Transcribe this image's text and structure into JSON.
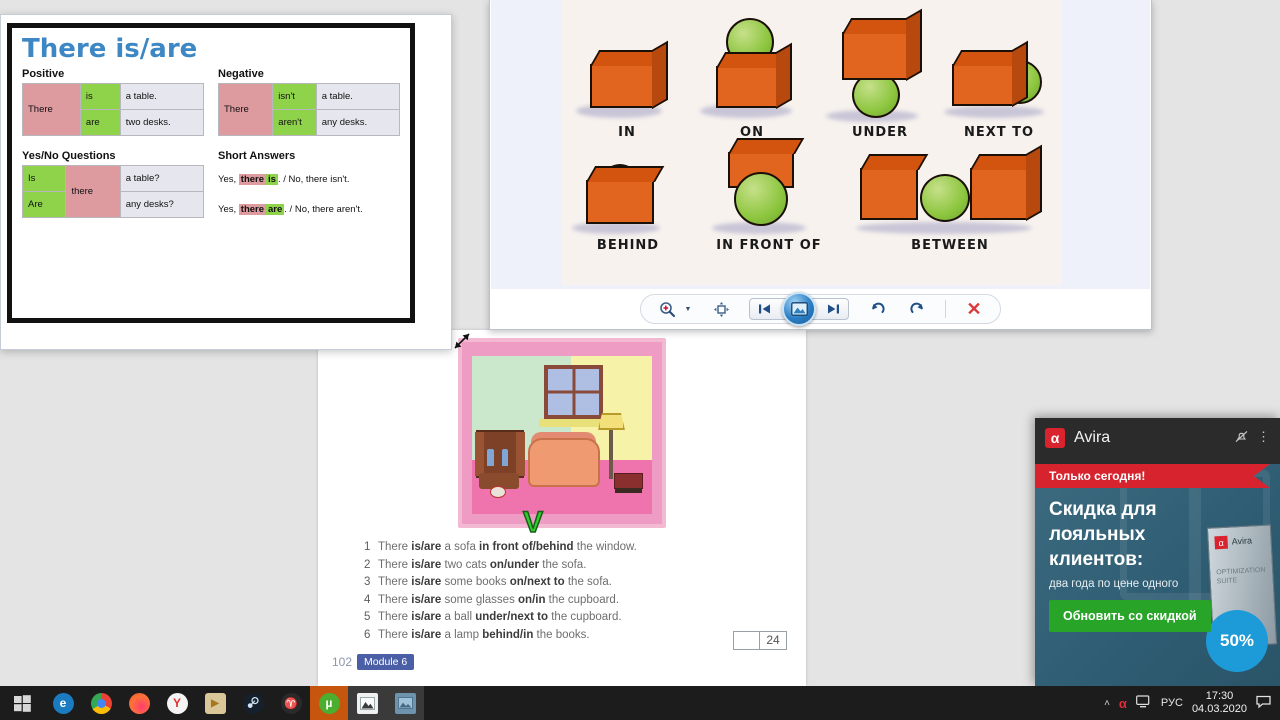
{
  "desktop": {
    "background_color": "#e4e4e4"
  },
  "grammar_window": {
    "title": "There is/are",
    "positive": {
      "heading": "Positive",
      "subject": "There",
      "rows": [
        {
          "verb": "is",
          "object": "a table."
        },
        {
          "verb": "are",
          "object": "two desks."
        }
      ]
    },
    "negative": {
      "heading": "Negative",
      "subject": "There",
      "rows": [
        {
          "verb": "isn't",
          "object": "a table."
        },
        {
          "verb": "aren't",
          "object": "any desks."
        }
      ]
    },
    "questions": {
      "heading": "Yes/No Questions",
      "subject": "there",
      "rows": [
        {
          "verb": "Is",
          "object": "a table?"
        },
        {
          "verb": "Are",
          "object": "any desks?"
        }
      ]
    },
    "answers": {
      "heading": "Short Answers",
      "lines": [
        {
          "yes_prefix": "Yes,",
          "hl_pink": "there",
          "hl_green": "is",
          "rest": ". / No, there isn't."
        },
        {
          "yes_prefix": "Yes,",
          "hl_pink": "there",
          "hl_green": "are",
          "rest": ". / No, there aren't."
        }
      ]
    },
    "resize_icon": "resize-diagonal-icon",
    "colors": {
      "pink": "#dd9ba0",
      "green": "#8fd34b",
      "gray": "#e6e6ee",
      "title_blue": "#3d87c4"
    }
  },
  "photo_viewer": {
    "image_alt": "prepositions-of-place-illustration",
    "prepositions": [
      {
        "label": "IN"
      },
      {
        "label": "ON"
      },
      {
        "label": "UNDER"
      },
      {
        "label": "NEXT TO"
      },
      {
        "label": "BEHIND"
      },
      {
        "label": "IN FRONT OF"
      },
      {
        "label": "BETWEEN"
      }
    ],
    "toolbar": {
      "zoom_label": "zoom-icon",
      "zoom_caret": "▼",
      "actual_size_label": "actual-size-icon",
      "previous_label": "◀❙",
      "slideshow_label": "slideshow-icon",
      "next_label": "❙▶",
      "rotate_ccw_label": "↺",
      "rotate_cw_label": "↻",
      "delete_label": "✕"
    }
  },
  "document": {
    "picture_alt": "living-room-illustration",
    "check_mark": "V",
    "exercises": [
      {
        "num": "1",
        "pre": "There ",
        "b1": "is/are",
        "mid": " a sofa ",
        "b2": "in front of/behind",
        "post": " the window."
      },
      {
        "num": "2",
        "pre": "There ",
        "b1": "is/are",
        "mid": " two cats ",
        "b2": "on/under",
        "post": " the sofa."
      },
      {
        "num": "3",
        "pre": "There ",
        "b1": "is/are",
        "mid": " some books ",
        "b2": "on/next to",
        "post": " the sofa."
      },
      {
        "num": "4",
        "pre": "There ",
        "b1": "is/are",
        "mid": " some glasses ",
        "b2": "on/in",
        "post": " the cupboard."
      },
      {
        "num": "5",
        "pre": "There ",
        "b1": "is/are",
        "mid": " a ball ",
        "b2": "under/next to",
        "post": " the cupboard."
      },
      {
        "num": "6",
        "pre": "There ",
        "b1": "is/are",
        "mid": " a lamp ",
        "b2": "behind/in",
        "post": " the books."
      }
    ],
    "score": "24",
    "page_number": "102",
    "module_label": "Module 6"
  },
  "avira_popup": {
    "app_name": "Avira",
    "logo_glyph": "α",
    "mute_icon": "bell-muted-icon",
    "menu_icon": "more-icon",
    "ribbon_text": "Только сегодня!",
    "title": "Скидка для лояльных клиентов:",
    "subtitle": "два года по цене одного",
    "cta_label": "Обновить со скидкой",
    "badge": "50%",
    "product_box": {
      "brand": "Avira",
      "line1": "OPTIMIZATION",
      "line2": "SUITE"
    },
    "colors": {
      "ribbon_red": "#d6232e",
      "cta_green": "#28a428",
      "badge_blue": "#1d9bd8"
    }
  },
  "taskbar": {
    "items": [
      {
        "name": "start",
        "glyph": "⊞",
        "color": "#ffffff",
        "bg": "transparent"
      },
      {
        "name": "edge",
        "glyph": "e",
        "color": "#ffffff",
        "bg": "#1a7bc0"
      },
      {
        "name": "chrome",
        "glyph": "●",
        "color": "#ffffff",
        "bg": "#4285f4"
      },
      {
        "name": "firefox",
        "glyph": "●",
        "color": "#ffffff",
        "bg": "#e55b1f"
      },
      {
        "name": "yandex",
        "glyph": "Y",
        "color": "#e03030",
        "bg": "#f2f2f2"
      },
      {
        "name": "media-player",
        "glyph": "▶",
        "color": "#c98a2a",
        "bg": "#d9c79a"
      },
      {
        "name": "steam",
        "glyph": "●",
        "color": "#ffffff",
        "bg": "#1b2838"
      },
      {
        "name": "world-of-tanks",
        "glyph": "♈",
        "color": "#cfcfcf",
        "bg": "#2a2a2a"
      },
      {
        "name": "utorrent",
        "glyph": "µ",
        "color": "#ffffff",
        "bg": "#4cae2e"
      },
      {
        "name": "photo-viewer",
        "glyph": "▲",
        "color": "#ffffff",
        "bg": "#3a3a3a"
      },
      {
        "name": "photos-app",
        "glyph": "▣",
        "color": "#a9c3d8",
        "bg": "#3a3a3a"
      }
    ],
    "tray": {
      "chevron": "˄",
      "avira_glyph": "α",
      "network_icon": "network-icon",
      "language": "РУС",
      "time": "17:30",
      "date": "04.03.2020",
      "action_center_icon": "action-center-icon"
    }
  }
}
